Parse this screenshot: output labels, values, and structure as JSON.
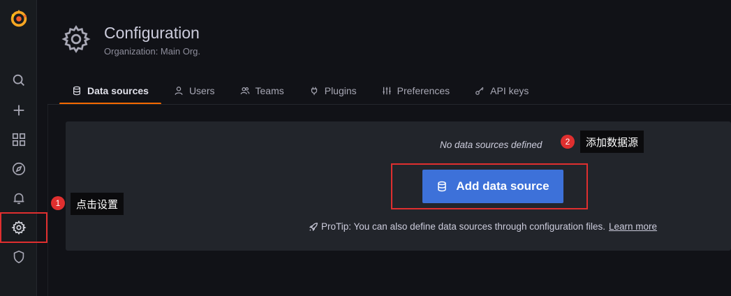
{
  "sidebar": {
    "items": [
      {
        "name": "grafana-logo",
        "icon": "grafana-logo"
      },
      {
        "name": "search",
        "icon": "search-icon"
      },
      {
        "name": "create",
        "icon": "plus-icon"
      },
      {
        "name": "dashboards",
        "icon": "apps-icon"
      },
      {
        "name": "explore",
        "icon": "compass-icon"
      },
      {
        "name": "alerting",
        "icon": "bell-icon"
      },
      {
        "name": "configuration",
        "icon": "gear-icon"
      },
      {
        "name": "server-admin",
        "icon": "shield-icon"
      }
    ]
  },
  "header": {
    "title": "Configuration",
    "subtitle": "Organization: Main Org.",
    "icon": "gear-icon"
  },
  "tabs": [
    {
      "label": "Data sources",
      "icon": "database-icon",
      "active": true
    },
    {
      "label": "Users",
      "icon": "user-icon",
      "active": false
    },
    {
      "label": "Teams",
      "icon": "users-icon",
      "active": false
    },
    {
      "label": "Plugins",
      "icon": "plug-icon",
      "active": false
    },
    {
      "label": "Preferences",
      "icon": "sliders-icon",
      "active": false
    },
    {
      "label": "API keys",
      "icon": "key-icon",
      "active": false
    }
  ],
  "empty": {
    "message": "No data sources defined",
    "button_label": "Add data source",
    "protip": "ProTip: You can also define data sources through configuration files.",
    "learn_more": "Learn more"
  },
  "annotations": {
    "step1": {
      "number": "1",
      "text": "点击设置"
    },
    "step2": {
      "number": "2",
      "text": "添加数据源"
    }
  },
  "colors": {
    "accent_orange": "#f46800",
    "primary_button": "#3d71d9",
    "annotation_red": "#e02f2f"
  }
}
